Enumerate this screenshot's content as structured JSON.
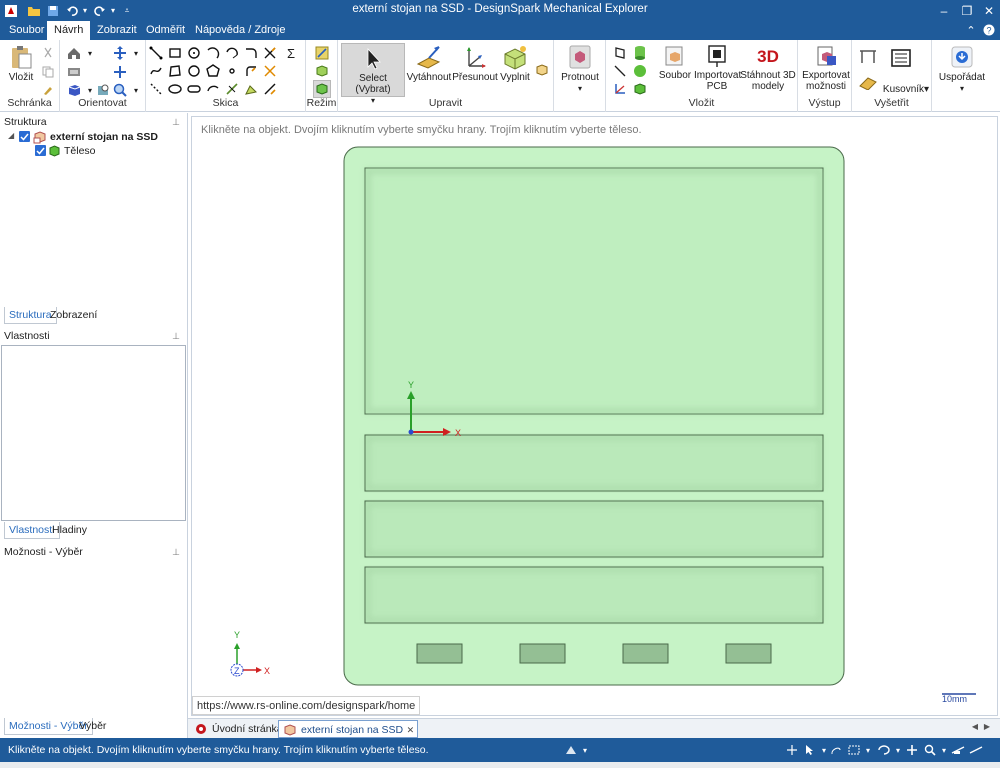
{
  "window": {
    "title": "externí stojan na SSD - DesignSpark Mechanical Explorer",
    "minimize": "–",
    "restore": "❐",
    "close": "✕"
  },
  "menu": {
    "tabs": [
      "Soubor",
      "Návrh",
      "Zobrazit",
      "Odměřit",
      "Nápověda / Zdroje"
    ],
    "active_tab": "Návrh"
  },
  "ribbon": {
    "groups": {
      "clipboard": "Schránka",
      "orient": "Orientovat",
      "sketch": "Skica",
      "mode": "Režim",
      "edit": "Upravit",
      "insert": "Vložit",
      "output": "Výstup",
      "inspect": "Vyšetřit"
    },
    "buttons": {
      "paste": "Vložit",
      "select": "Select (Vybrat)",
      "pull": "Vytáhnout",
      "move": "Přesunout",
      "fill": "Vyplnit",
      "intersect": "Protnout",
      "file": "Soubor",
      "import_pcb": "Importovat PCB",
      "download_3d": "Stáhnout 3D modely",
      "export_options": "Exportovat možnosti",
      "bom": "Kusovník",
      "arrange": "Uspořádat"
    }
  },
  "structure_panel": {
    "title": "Struktura",
    "root": "externí stojan na SSD",
    "child": "Těleso",
    "tabs": [
      "Struktura",
      "Zobrazení"
    ]
  },
  "properties_panel": {
    "title": "Vlastnosti",
    "tabs": [
      "Vlastnosti",
      "Hladiny"
    ]
  },
  "options_panel": {
    "title": "Možnosti - Výběr",
    "tabs": [
      "Možnosti - Výběr",
      "Výběr"
    ]
  },
  "viewport": {
    "hint": "Klikněte na objekt. Dvojím kliknutím vyberte smyčku hrany. Trojím kliknutím vyberte těleso.",
    "url": "https://www.rs-online.com/designspark/home",
    "scale_label": "10mm",
    "axis_y": "Y",
    "axis_x": "X",
    "axis_z": "Z",
    "model_color": "#c6f3c6",
    "model_edge": "#4a6a4a"
  },
  "doc_tabs": {
    "start": "Úvodní stránka",
    "active": "externí stojan na SSD"
  },
  "status": {
    "text": "Klikněte na objekt. Dvojím kliknutím vyberte smyčku hrany. Trojím kliknutím vyberte těleso."
  }
}
